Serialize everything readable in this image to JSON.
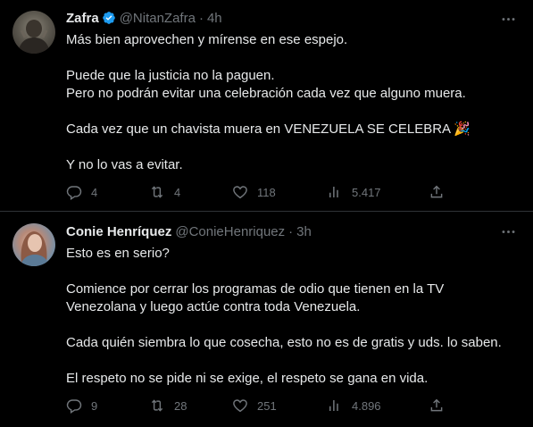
{
  "tweets": [
    {
      "name": "Zafra",
      "verified": true,
      "handle": "@NitanZafra",
      "time": "4h",
      "paragraphs": [
        "Más bien aprovechen y mírense en ese espejo.",
        "Puede que la justicia no la paguen.\nPero no podrán evitar una celebración cada vez que alguno muera.",
        "Cada vez que un chavista muera en VENEZUELA SE CELEBRA 🎉",
        "Y no lo vas a evitar."
      ],
      "replies": "4",
      "retweets": "4",
      "likes": "118",
      "views": "5.417"
    },
    {
      "name": "Conie Henríquez",
      "verified": false,
      "handle": "@ConieHenriquez",
      "time": "3h",
      "paragraphs": [
        "Esto es en serio?",
        "Comience por cerrar los programas de odio que tienen en la TV\nVenezolana y luego actúe contra toda Venezuela.",
        "Cada quién siembra lo que cosecha, esto no es de gratis y uds. lo saben.",
        "El respeto no se pide ni se exige, el respeto se gana en vida."
      ],
      "replies": "9",
      "retweets": "28",
      "likes": "251",
      "views": "4.896"
    }
  ],
  "dot_separator": "·",
  "colors": {
    "background": "#000000",
    "text": "#e7e9ea",
    "muted": "#71767b",
    "verified_badge": "#1d9bf0",
    "divider": "#2f3336"
  },
  "icons": [
    "more-icon",
    "verified-badge-icon",
    "reply-icon",
    "retweet-icon",
    "like-icon",
    "views-icon",
    "share-icon"
  ]
}
